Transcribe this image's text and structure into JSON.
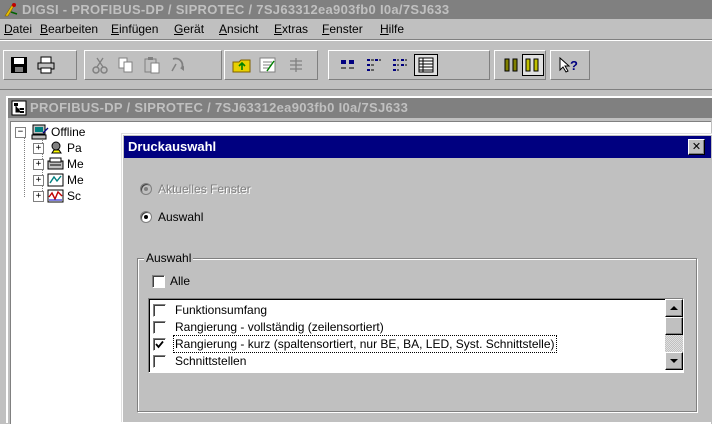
{
  "app": {
    "title": "DIGSI - PROFIBUS-DP / SIPROTEC / 7SJ63312ea903fb0 I0a/7SJ633"
  },
  "menu": {
    "items": [
      {
        "label": "Datei"
      },
      {
        "label": "Bearbeiten"
      },
      {
        "label": "Einfügen"
      },
      {
        "label": "Gerät"
      },
      {
        "label": "Ansicht"
      },
      {
        "label": "Extras"
      },
      {
        "label": "Fenster"
      },
      {
        "label": "Hilfe"
      }
    ]
  },
  "toolbar": {
    "icons": [
      "save-icon",
      "print-icon",
      "cut-icon",
      "copy-icon",
      "paste-icon",
      "undo-icon",
      "up-folder-icon",
      "properties-icon",
      "align-icon",
      "large-icons-icon",
      "small-icons-icon",
      "list-icon",
      "details-icon",
      "single-window-icon",
      "multi-window-icon",
      "help-icon"
    ]
  },
  "child_window": {
    "title": "PROFIBUS-DP / SIPROTEC / 7SJ63312ea903fb0 I0a/7SJ633"
  },
  "tree": {
    "root": "Offline",
    "children": [
      "Pa",
      "Me",
      "Me",
      "Sc"
    ]
  },
  "dialog": {
    "title": "Druckauswahl",
    "close_label": "✕",
    "radio_current": "Aktuelles Fenster",
    "radio_selection": "Auswahl",
    "group_label": "Auswahl",
    "all_label": "Alle",
    "list_items": [
      {
        "label": "Funktionsumfang",
        "checked": false
      },
      {
        "label": "Rangierung - vollständig (zeilensortiert)",
        "checked": false
      },
      {
        "label": "Rangierung - kurz (spaltensortiert, nur BE, BA, LED, Syst. Schnittstelle)",
        "checked": true
      },
      {
        "label": "Schnittstellen",
        "checked": false
      }
    ]
  }
}
